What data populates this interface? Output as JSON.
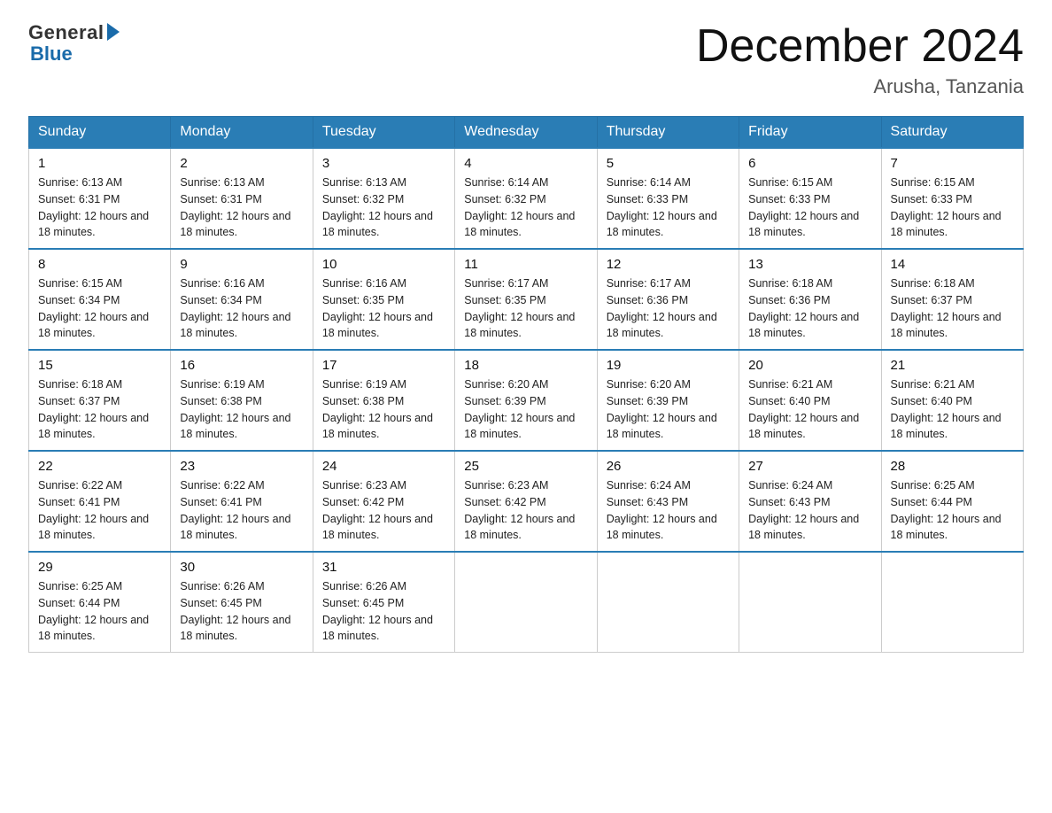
{
  "header": {
    "logo_general": "General",
    "logo_blue": "Blue",
    "title": "December 2024",
    "location": "Arusha, Tanzania"
  },
  "days_of_week": [
    "Sunday",
    "Monday",
    "Tuesday",
    "Wednesday",
    "Thursday",
    "Friday",
    "Saturday"
  ],
  "weeks": [
    [
      {
        "day": "1",
        "sunrise": "6:13 AM",
        "sunset": "6:31 PM",
        "daylight": "12 hours and 18 minutes."
      },
      {
        "day": "2",
        "sunrise": "6:13 AM",
        "sunset": "6:31 PM",
        "daylight": "12 hours and 18 minutes."
      },
      {
        "day": "3",
        "sunrise": "6:13 AM",
        "sunset": "6:32 PM",
        "daylight": "12 hours and 18 minutes."
      },
      {
        "day": "4",
        "sunrise": "6:14 AM",
        "sunset": "6:32 PM",
        "daylight": "12 hours and 18 minutes."
      },
      {
        "day": "5",
        "sunrise": "6:14 AM",
        "sunset": "6:33 PM",
        "daylight": "12 hours and 18 minutes."
      },
      {
        "day": "6",
        "sunrise": "6:15 AM",
        "sunset": "6:33 PM",
        "daylight": "12 hours and 18 minutes."
      },
      {
        "day": "7",
        "sunrise": "6:15 AM",
        "sunset": "6:33 PM",
        "daylight": "12 hours and 18 minutes."
      }
    ],
    [
      {
        "day": "8",
        "sunrise": "6:15 AM",
        "sunset": "6:34 PM",
        "daylight": "12 hours and 18 minutes."
      },
      {
        "day": "9",
        "sunrise": "6:16 AM",
        "sunset": "6:34 PM",
        "daylight": "12 hours and 18 minutes."
      },
      {
        "day": "10",
        "sunrise": "6:16 AM",
        "sunset": "6:35 PM",
        "daylight": "12 hours and 18 minutes."
      },
      {
        "day": "11",
        "sunrise": "6:17 AM",
        "sunset": "6:35 PM",
        "daylight": "12 hours and 18 minutes."
      },
      {
        "day": "12",
        "sunrise": "6:17 AM",
        "sunset": "6:36 PM",
        "daylight": "12 hours and 18 minutes."
      },
      {
        "day": "13",
        "sunrise": "6:18 AM",
        "sunset": "6:36 PM",
        "daylight": "12 hours and 18 minutes."
      },
      {
        "day": "14",
        "sunrise": "6:18 AM",
        "sunset": "6:37 PM",
        "daylight": "12 hours and 18 minutes."
      }
    ],
    [
      {
        "day": "15",
        "sunrise": "6:18 AM",
        "sunset": "6:37 PM",
        "daylight": "12 hours and 18 minutes."
      },
      {
        "day": "16",
        "sunrise": "6:19 AM",
        "sunset": "6:38 PM",
        "daylight": "12 hours and 18 minutes."
      },
      {
        "day": "17",
        "sunrise": "6:19 AM",
        "sunset": "6:38 PM",
        "daylight": "12 hours and 18 minutes."
      },
      {
        "day": "18",
        "sunrise": "6:20 AM",
        "sunset": "6:39 PM",
        "daylight": "12 hours and 18 minutes."
      },
      {
        "day": "19",
        "sunrise": "6:20 AM",
        "sunset": "6:39 PM",
        "daylight": "12 hours and 18 minutes."
      },
      {
        "day": "20",
        "sunrise": "6:21 AM",
        "sunset": "6:40 PM",
        "daylight": "12 hours and 18 minutes."
      },
      {
        "day": "21",
        "sunrise": "6:21 AM",
        "sunset": "6:40 PM",
        "daylight": "12 hours and 18 minutes."
      }
    ],
    [
      {
        "day": "22",
        "sunrise": "6:22 AM",
        "sunset": "6:41 PM",
        "daylight": "12 hours and 18 minutes."
      },
      {
        "day": "23",
        "sunrise": "6:22 AM",
        "sunset": "6:41 PM",
        "daylight": "12 hours and 18 minutes."
      },
      {
        "day": "24",
        "sunrise": "6:23 AM",
        "sunset": "6:42 PM",
        "daylight": "12 hours and 18 minutes."
      },
      {
        "day": "25",
        "sunrise": "6:23 AM",
        "sunset": "6:42 PM",
        "daylight": "12 hours and 18 minutes."
      },
      {
        "day": "26",
        "sunrise": "6:24 AM",
        "sunset": "6:43 PM",
        "daylight": "12 hours and 18 minutes."
      },
      {
        "day": "27",
        "sunrise": "6:24 AM",
        "sunset": "6:43 PM",
        "daylight": "12 hours and 18 minutes."
      },
      {
        "day": "28",
        "sunrise": "6:25 AM",
        "sunset": "6:44 PM",
        "daylight": "12 hours and 18 minutes."
      }
    ],
    [
      {
        "day": "29",
        "sunrise": "6:25 AM",
        "sunset": "6:44 PM",
        "daylight": "12 hours and 18 minutes."
      },
      {
        "day": "30",
        "sunrise": "6:26 AM",
        "sunset": "6:45 PM",
        "daylight": "12 hours and 18 minutes."
      },
      {
        "day": "31",
        "sunrise": "6:26 AM",
        "sunset": "6:45 PM",
        "daylight": "12 hours and 18 minutes."
      },
      null,
      null,
      null,
      null
    ]
  ]
}
